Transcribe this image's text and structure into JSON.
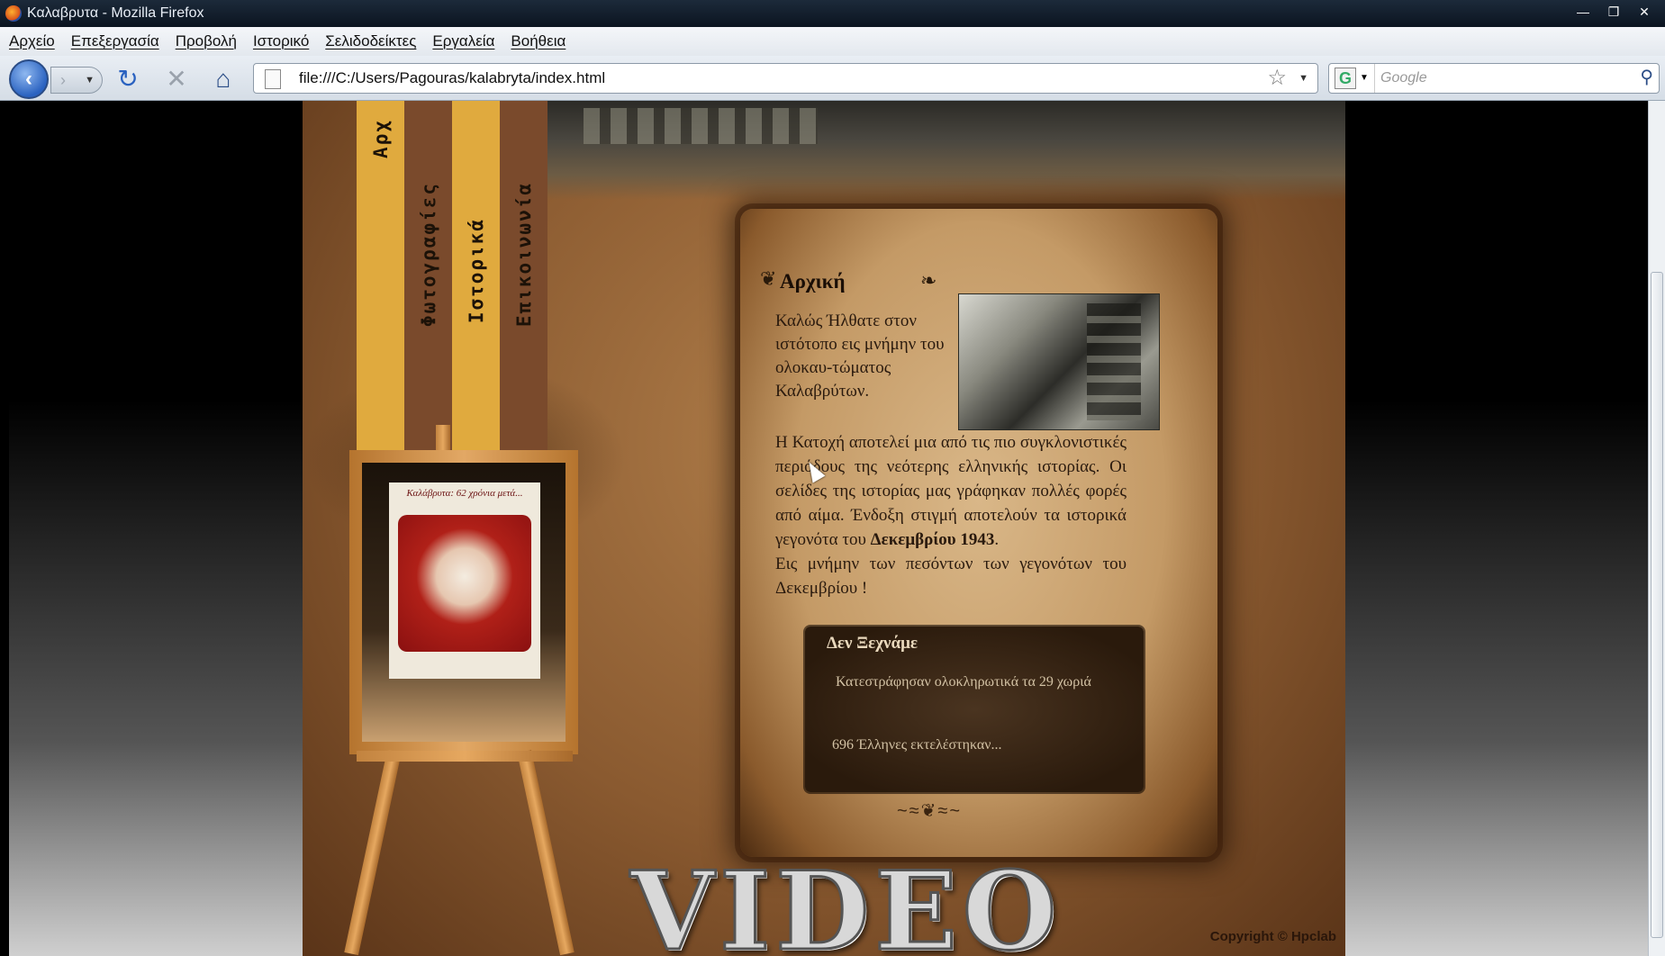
{
  "window": {
    "title": "Καλαβρυτα - Mozilla Firefox",
    "controls": [
      "—",
      "❐",
      "✕"
    ]
  },
  "menu": [
    "Αρχείο",
    "Επεξεργασία",
    "Προβολή",
    "Ιστορικό",
    "Σελιδοδείκτες",
    "Εργαλεία",
    "Βοήθεια"
  ],
  "nav": {
    "url": "file:///C:/Users/Pagouras/kalabryta/index.html",
    "search_placeholder": "Google",
    "search_engine": "G"
  },
  "site": {
    "nav_items": [
      "Αρχ",
      "Φωτογραφίες",
      "Ιστορικά",
      "Επικοινωνία"
    ],
    "nav_colors": [
      "#e0aa3e",
      "#7a4a2c",
      "#e0aa3e",
      "#7a4a2c"
    ],
    "poster_title": "Καλάβρυτα: 62 χρόνια μετά...",
    "heading": "Αρχική",
    "intro": "Καλώς Ήλθατε στον ιστότοπο εις μνήμην του ολοκαυ-τώματος Καλαβρύτων.",
    "body_text": "Η Κατοχή αποτελεί μια από τις πιο συγκλονιστικές περιόδους της νεότερης ελληνικής ιστορίας. Οι σελίδες της ιστορίας μας γράφηκαν πολλές φορές από αίμα. Ένδοξη στιγμή αποτελούν τα ιστορικά γεγονότα του ",
    "body_bold": "Δεκεμβρίου 1943",
    "body_after": ".",
    "body_memory": "Εις μνήμην των πεσόντων των γεγονότων του Δεκεμβρίου !",
    "box_title": "Δεν Ξεχνάμε",
    "box_lines": [
      "Κατεστράφησαν ολοκληρωτικά τα 29 χωριά",
      "696 Έλληνες εκτελέστηκαν..."
    ],
    "video_label": "VIDEO",
    "copyright": "Copyright © Hpclab"
  }
}
